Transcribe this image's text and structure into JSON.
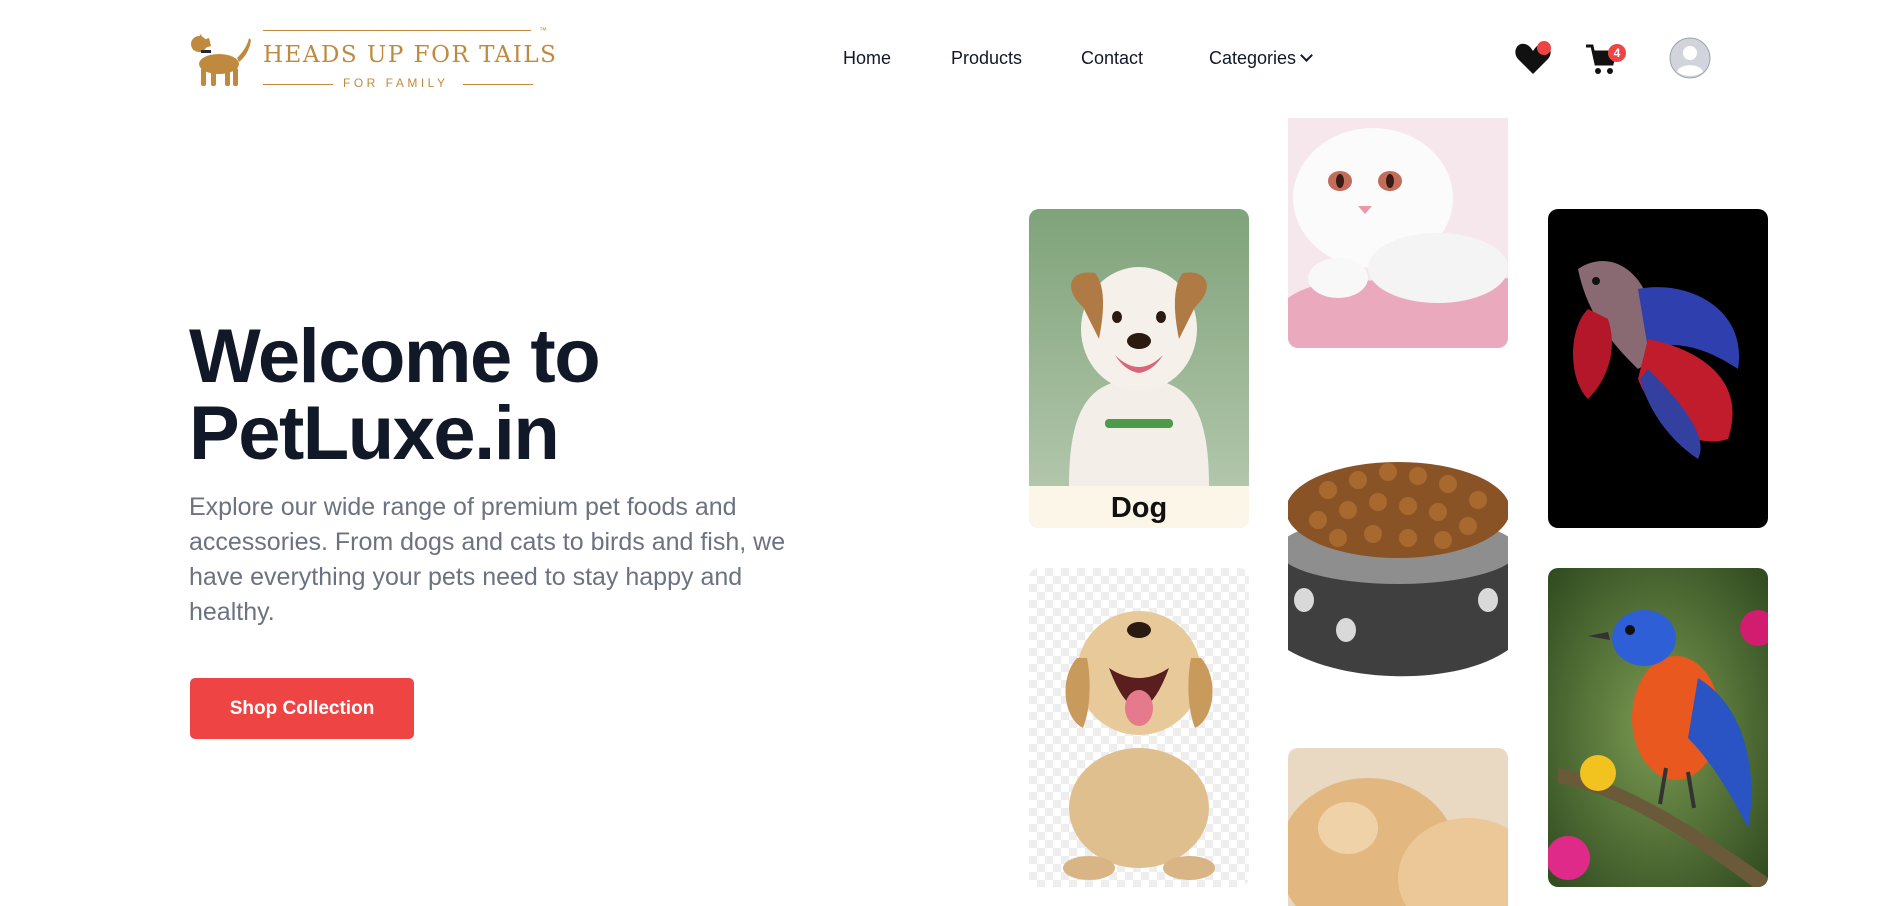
{
  "brand": {
    "title": "HEADS UP FOR TAILS",
    "subtitle": "FOR FAMILY",
    "trademark": "™",
    "color": "#c08a3e"
  },
  "nav": {
    "items": [
      "Home",
      "Products",
      "Contact",
      "Categories"
    ]
  },
  "header_icons": {
    "wishlist": "heart-icon",
    "cart": "cart-icon",
    "cart_count": "4",
    "profile": "user-avatar-icon"
  },
  "hero": {
    "title_line1": "Welcome to",
    "title_line2": "PetLuxe.in",
    "description": "Explore our wide range of premium pet foods and accessories. From dogs and cats to birds and fish, we have everything your pets need to stay happy and healthy.",
    "button_label": "Shop Collection"
  },
  "tiles": {
    "dog_label": "Dog",
    "images": [
      "dog-photo",
      "puppy-photo",
      "cat-photo",
      "pet-food-bowl-photo",
      "puppy-closeup-photo",
      "fish-photo",
      "bird-photo"
    ]
  },
  "colors": {
    "accent": "#ef4444",
    "text_dark": "#111827",
    "text_muted": "#6b7280",
    "dog_label_bg": "#fbf6e7"
  }
}
